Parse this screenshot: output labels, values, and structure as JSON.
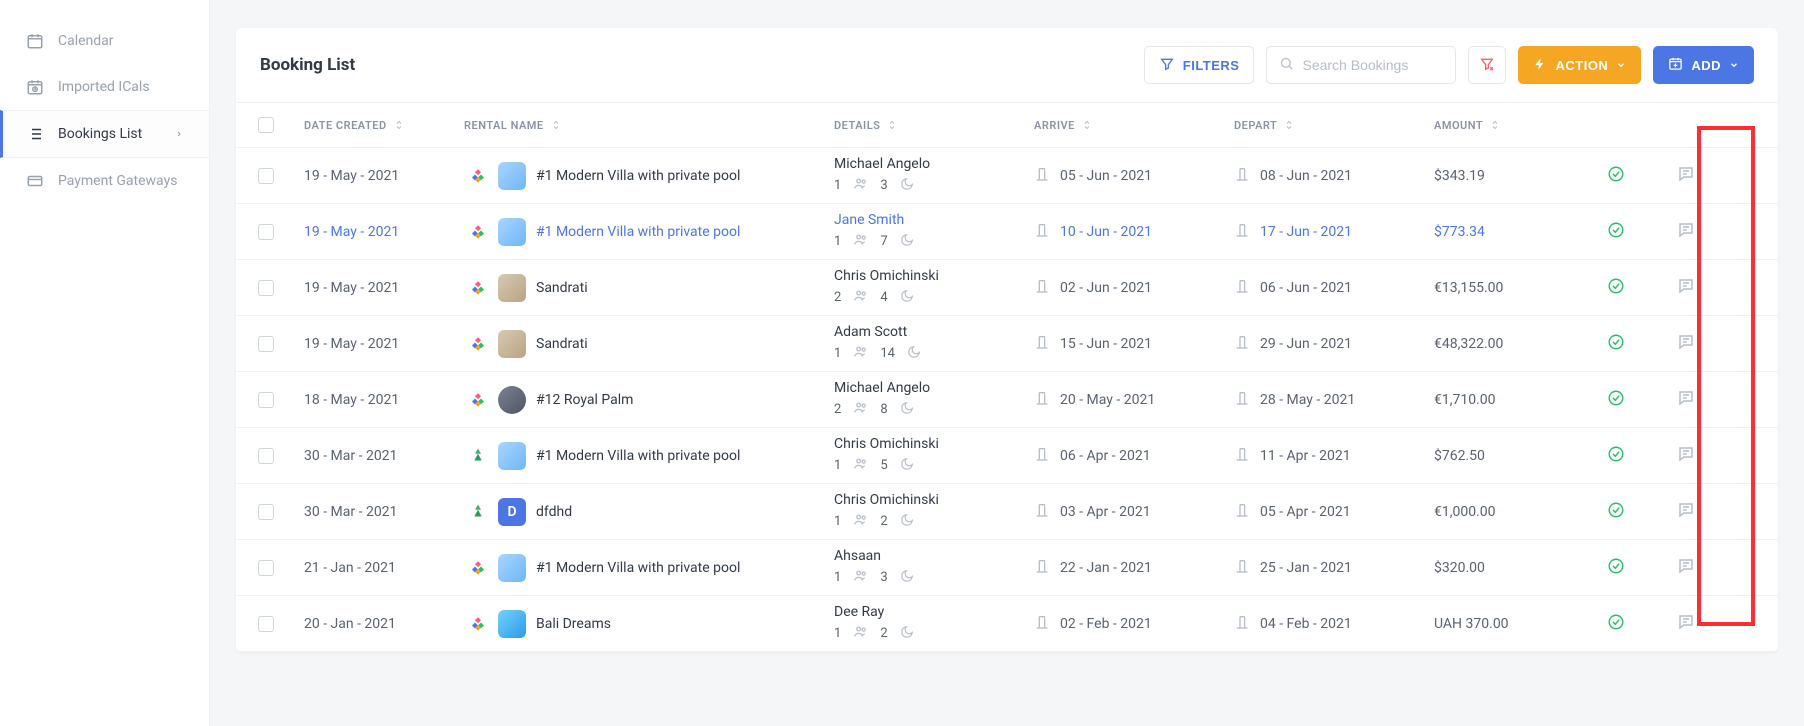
{
  "sidebar": {
    "items": [
      {
        "label": "Calendar",
        "icon": "calendar-icon",
        "active": false
      },
      {
        "label": "Imported ICals",
        "icon": "calendar-clock-icon",
        "active": false
      },
      {
        "label": "Bookings List",
        "icon": "list-icon",
        "active": true,
        "chevron": true
      },
      {
        "label": "Payment Gateways",
        "icon": "card-icon",
        "active": false
      }
    ]
  },
  "header": {
    "title": "Booking List",
    "filters_label": "FILTERS",
    "search_placeholder": "Search Bookings",
    "action_label": "ACTION",
    "add_label": "ADD"
  },
  "columns": {
    "date_created": "DATE CREATED",
    "rental_name": "RENTAL NAME",
    "details": "DETAILS",
    "arrive": "ARRIVE",
    "depart": "DEPART",
    "amount": "AMOUNT"
  },
  "rows": [
    {
      "date": "19 - May - 2021",
      "rental": "#1 Modern Villa with private pool",
      "iconA": "multi",
      "iconB": "img",
      "guest": "Michael Angelo",
      "guests": "1",
      "nights": "3",
      "arrive": "05 - Jun - 2021",
      "depart": "08 - Jun - 2021",
      "amount": "$343.19",
      "highlighted": false
    },
    {
      "date": "19 - May - 2021",
      "rental": "#1 Modern Villa with private pool",
      "iconA": "multi",
      "iconB": "img",
      "guest": "Jane Smith",
      "guests": "1",
      "nights": "7",
      "arrive": "10 - Jun - 2021",
      "depart": "17 - Jun - 2021",
      "amount": "$773.34",
      "highlighted": true
    },
    {
      "date": "19 - May - 2021",
      "rental": "Sandrati",
      "iconA": "multi",
      "iconB": "villa",
      "guest": "Chris Omichinski",
      "guests": "2",
      "nights": "4",
      "arrive": "02 - Jun - 2021",
      "depart": "06 - Jun - 2021",
      "amount": "€13,155.00",
      "highlighted": false
    },
    {
      "date": "19 - May - 2021",
      "rental": "Sandrati",
      "iconA": "multi",
      "iconB": "villa",
      "guest": "Adam Scott",
      "guests": "1",
      "nights": "14",
      "arrive": "15 - Jun - 2021",
      "depart": "29 - Jun - 2021",
      "amount": "€48,322.00",
      "highlighted": false
    },
    {
      "date": "18 - May - 2021",
      "rental": "#12 Royal Palm",
      "iconA": "multi",
      "iconB": "palm",
      "guest": "Michael Angelo",
      "guests": "2",
      "nights": "8",
      "arrive": "20 - May - 2021",
      "depart": "28 - May - 2021",
      "amount": "€1,710.00",
      "highlighted": false
    },
    {
      "date": "30 - Mar - 2021",
      "rental": "#1 Modern Villa with private pool",
      "iconA": "green",
      "iconB": "img",
      "guest": "Chris Omichinski",
      "guests": "1",
      "nights": "5",
      "arrive": "06 - Apr - 2021",
      "depart": "11 - Apr - 2021",
      "amount": "$762.50",
      "highlighted": false
    },
    {
      "date": "30 - Mar - 2021",
      "rental": "dfdhd",
      "iconA": "green",
      "iconB": "letter",
      "letter": "D",
      "guest": "Chris Omichinski",
      "guests": "1",
      "nights": "2",
      "arrive": "03 - Apr - 2021",
      "depart": "05 - Apr - 2021",
      "amount": "€1,000.00",
      "highlighted": false
    },
    {
      "date": "21 - Jan - 2021",
      "rental": "#1 Modern Villa with private pool",
      "iconA": "multi",
      "iconB": "img",
      "guest": "Ahsaan",
      "guests": "1",
      "nights": "3",
      "arrive": "22 - Jan - 2021",
      "depart": "25 - Jan - 2021",
      "amount": "$320.00",
      "highlighted": false
    },
    {
      "date": "20 - Jan - 2021",
      "rental": "Bali Dreams",
      "iconA": "multi",
      "iconB": "bali",
      "guest": "Dee Ray",
      "guests": "1",
      "nights": "2",
      "arrive": "02 - Feb - 2021",
      "depart": "04 - Feb - 2021",
      "amount": "UAH 370.00",
      "highlighted": false
    }
  ]
}
